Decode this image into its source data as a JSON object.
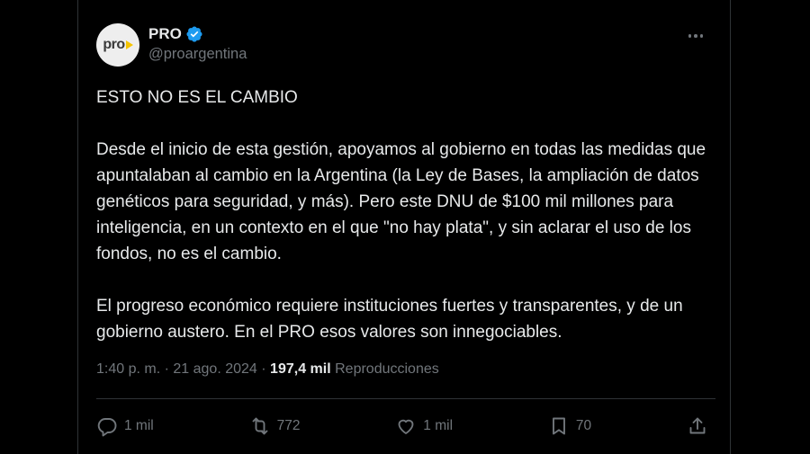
{
  "account": {
    "avatar_text": "pro",
    "display_name": "PRO",
    "handle": "@proargentina",
    "verified_color": "#1d9bf0",
    "avatar_accent": "#f5c400"
  },
  "tweet": {
    "paragraphs": [
      "ESTO NO ES EL CAMBIO",
      "Desde el inicio de esta gestión, apoyamos al gobierno en todas las medidas que apuntalaban al cambio en la Argentina (la Ley de Bases, la ampliación de datos genéticos para seguridad, y más). Pero este DNU de $100 mil millones para inteligencia, en un contexto en el que \"no hay plata\", y sin aclarar el uso de los fondos, no es el cambio.",
      "El progreso económico requiere instituciones fuertes y transparentes, y de un gobierno austero. En el PRO esos valores son innegociables."
    ],
    "time": "1:40 p. m.",
    "separator": "·",
    "date": "21 ago. 2024",
    "views_count": "197,4 mil",
    "views_label": "Reproducciones"
  },
  "actions": {
    "reply": {
      "icon": "reply-icon",
      "count": "1 mil"
    },
    "repost": {
      "icon": "repost-icon",
      "count": "772"
    },
    "like": {
      "icon": "like-icon",
      "count": "1 mil"
    },
    "bookmark": {
      "icon": "bookmark-icon",
      "count": "70"
    },
    "share": {
      "icon": "share-icon"
    }
  }
}
